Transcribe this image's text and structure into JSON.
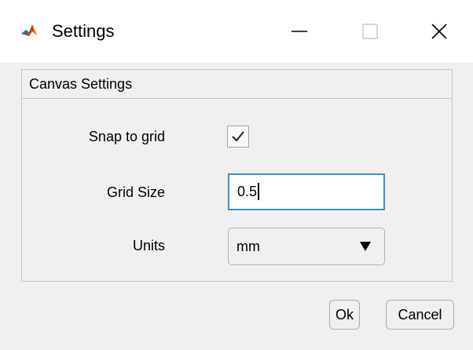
{
  "window": {
    "title": "Settings",
    "app_icon": "matlab-icon",
    "controls": {
      "minimize_icon": "minimize-icon",
      "maximize_icon": "maximize-icon",
      "close_icon": "close-icon"
    }
  },
  "panel": {
    "title": "Canvas Settings",
    "snap": {
      "label": "Snap to grid",
      "checked": true
    },
    "grid_size": {
      "label": "Grid Size",
      "value": "0.5"
    },
    "units": {
      "label": "Units",
      "selected": "mm"
    }
  },
  "buttons": {
    "ok": "Ok",
    "cancel": "Cancel"
  },
  "colors": {
    "input_focus_border": "#3b8fd6",
    "background": "#f0f0f0",
    "titlebar": "#ffffff"
  }
}
